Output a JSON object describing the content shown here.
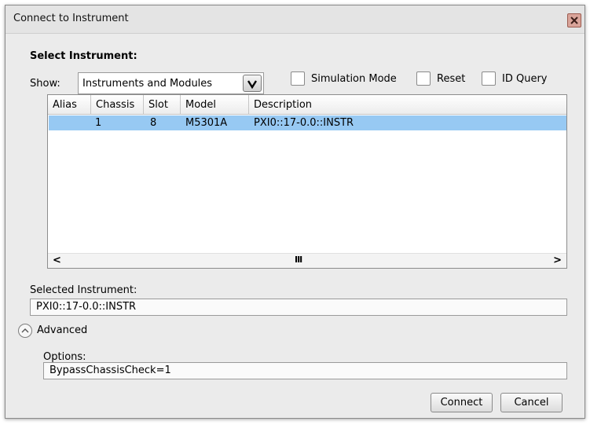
{
  "window": {
    "title": "Connect to Instrument",
    "close_glyph": "X"
  },
  "select_instrument": {
    "heading": "Select Instrument:",
    "show_label": "Show:",
    "show_value": "Instruments and Modules",
    "checkboxes": [
      {
        "label": "Simulation Mode",
        "checked": false
      },
      {
        "label": "Reset",
        "checked": false
      },
      {
        "label": "ID Query",
        "checked": false
      }
    ]
  },
  "table": {
    "columns": [
      "Alias",
      "Chassis",
      "Slot",
      "Model",
      "Description"
    ],
    "rows": [
      {
        "alias": "",
        "chassis": "1",
        "slot": "8",
        "model": "M5301A",
        "description": "PXI0::17-0.0::INSTR",
        "selected": true
      }
    ],
    "scroll_left_glyph": "<",
    "scroll_thumb_glyph": "III",
    "scroll_right_glyph": ">",
    "selection_color": "#97c9f3"
  },
  "selected_instrument": {
    "label": "Selected Instrument:",
    "value": "PXI0::17-0.0::INSTR"
  },
  "advanced": {
    "label": "Advanced",
    "icon": "chevron-up-icon",
    "options_label": "Options:",
    "options_value": "BypassChassisCheck=1"
  },
  "buttons": {
    "connect": "Connect",
    "cancel": "Cancel"
  }
}
